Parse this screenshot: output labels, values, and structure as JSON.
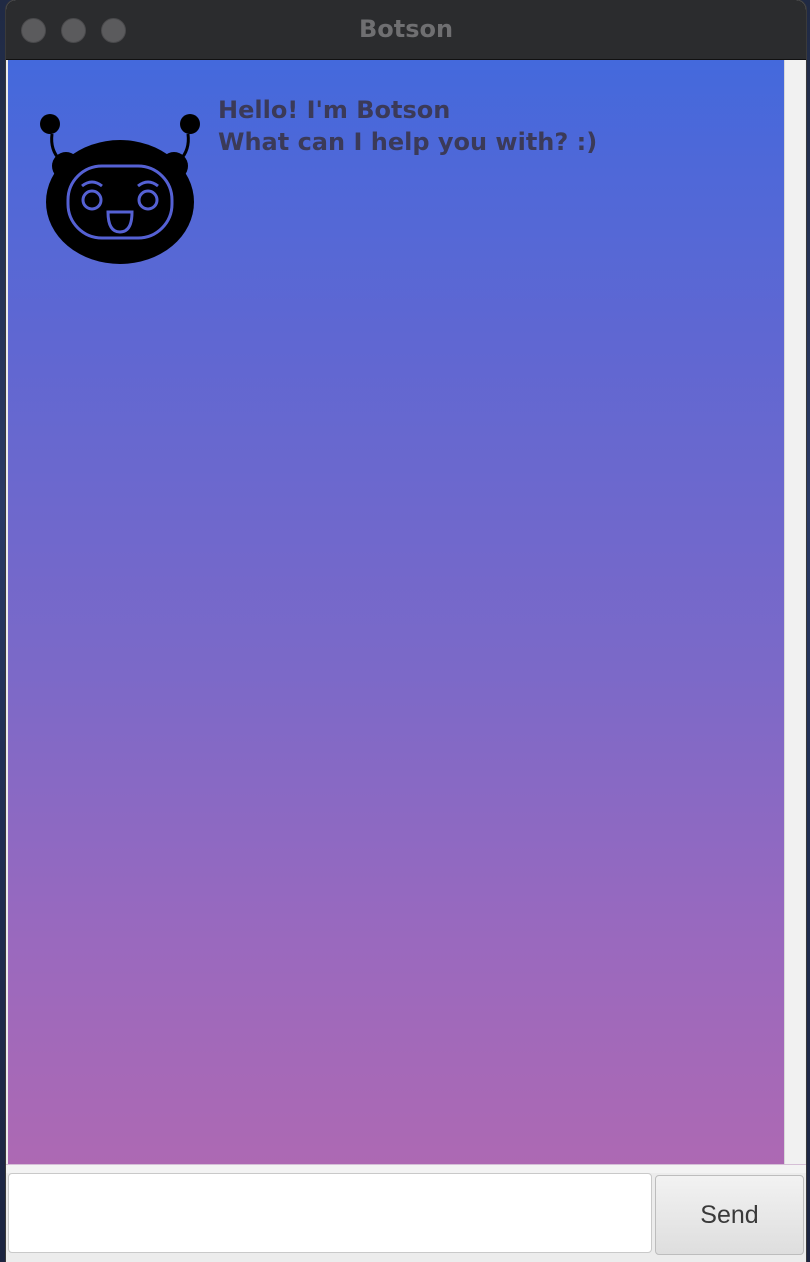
{
  "window": {
    "title": "Botson"
  },
  "chat": {
    "messages": [
      {
        "sender": "bot",
        "avatar_icon": "robot-face-icon",
        "lines": [
          "Hello! I'm Botson",
          "What can I help you with? :)"
        ]
      }
    ],
    "background_gradient": [
      "#4469dc",
      "#ad69b3"
    ]
  },
  "input": {
    "value": "",
    "placeholder": ""
  },
  "send_button": {
    "label": "Send"
  }
}
